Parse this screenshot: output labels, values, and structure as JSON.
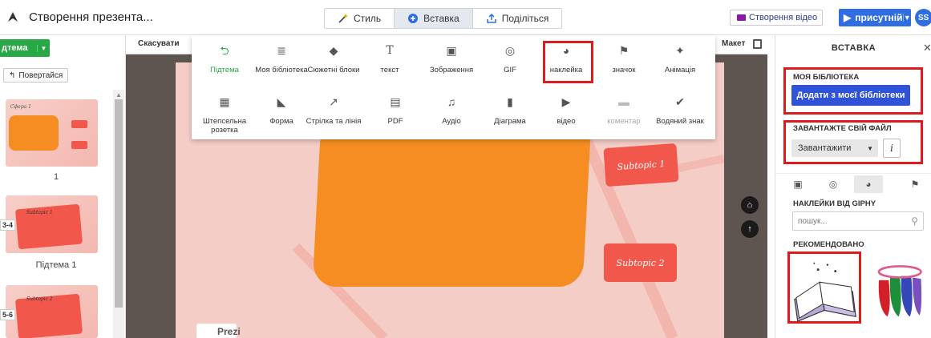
{
  "header": {
    "title": "Створення презента...",
    "tabs": [
      {
        "label": "Стиль",
        "icon": "magic-wand-icon"
      },
      {
        "label": "Вставка",
        "icon": "plus-circle-icon",
        "active": true
      },
      {
        "label": "Поділіться",
        "icon": "share-icon"
      }
    ],
    "create_video": "Створення відео",
    "present": "присутній",
    "avatar": "SS"
  },
  "left": {
    "topic_button": "дтема",
    "back_button": "Повертайся",
    "thumbnails": [
      {
        "label": "1",
        "badge": "",
        "title": "Сфера 1"
      },
      {
        "label": "Підтема 1",
        "badge": "3-4",
        "title": "Subtopic 1"
      },
      {
        "label": "",
        "badge": "5-6",
        "title": "Subtopic 2"
      }
    ]
  },
  "canvas": {
    "cancel": "Скасувати",
    "layout": "Макет",
    "subtopics": [
      "Subtopic 1",
      "Subtopic 2"
    ],
    "watermark": "Prezi"
  },
  "insert_menu": {
    "row1": [
      {
        "label": "Підтема",
        "icon": "subtopic-arrow-icon",
        "active": true
      },
      {
        "label": "Моя бібліотека",
        "icon": "library-icon"
      },
      {
        "label": "Сюжетні блоки",
        "icon": "layers-icon"
      },
      {
        "label": "текст",
        "icon": "text-icon"
      },
      {
        "label": "Зображення",
        "icon": "image-icon"
      },
      {
        "label": "GIF",
        "icon": "gif-icon"
      },
      {
        "label": "наклейка",
        "icon": "sticker-icon"
      },
      {
        "label": "значок",
        "icon": "flag-icon"
      },
      {
        "label": "Анімація",
        "icon": "animation-icon"
      }
    ],
    "row2": [
      {
        "label": "Штепсельна розетка",
        "icon": "plugin-icon"
      },
      {
        "label": "Форма",
        "icon": "shape-icon"
      },
      {
        "label": "Стрілка та лінія",
        "icon": "arrow-icon"
      },
      {
        "label": "PDF",
        "icon": "pdf-icon"
      },
      {
        "label": "Аудіо",
        "icon": "music-note-icon"
      },
      {
        "label": "Діаграма",
        "icon": "chart-icon"
      },
      {
        "label": "відео",
        "icon": "video-icon"
      },
      {
        "label": "коментар",
        "icon": "comment-icon",
        "disabled": true
      },
      {
        "label": "Водяний знак",
        "icon": "watermark-icon"
      }
    ]
  },
  "right_panel": {
    "title": "ВСТАВКА",
    "my_library_label": "МОЯ БІБЛІОТЕКА",
    "add_from_library": "Додати з моєї бібліотеки",
    "upload_label": "ЗАВАНТАЖТЕ СВІЙ ФАЙЛ",
    "upload_button": "Завантажити",
    "info": "i",
    "giphy_label": "НАКЛЕЙКИ ВІД GIPHY",
    "search_placeholder": "пошук...",
    "recommended_label": "РЕКОМЕНДОВАНО"
  },
  "colors": {
    "accent_green": "#28a745",
    "primary_blue": "#2f52d6",
    "highlight_red": "#e0191f",
    "center_topic": "#f58d22",
    "subtopic": "#f2574b"
  }
}
